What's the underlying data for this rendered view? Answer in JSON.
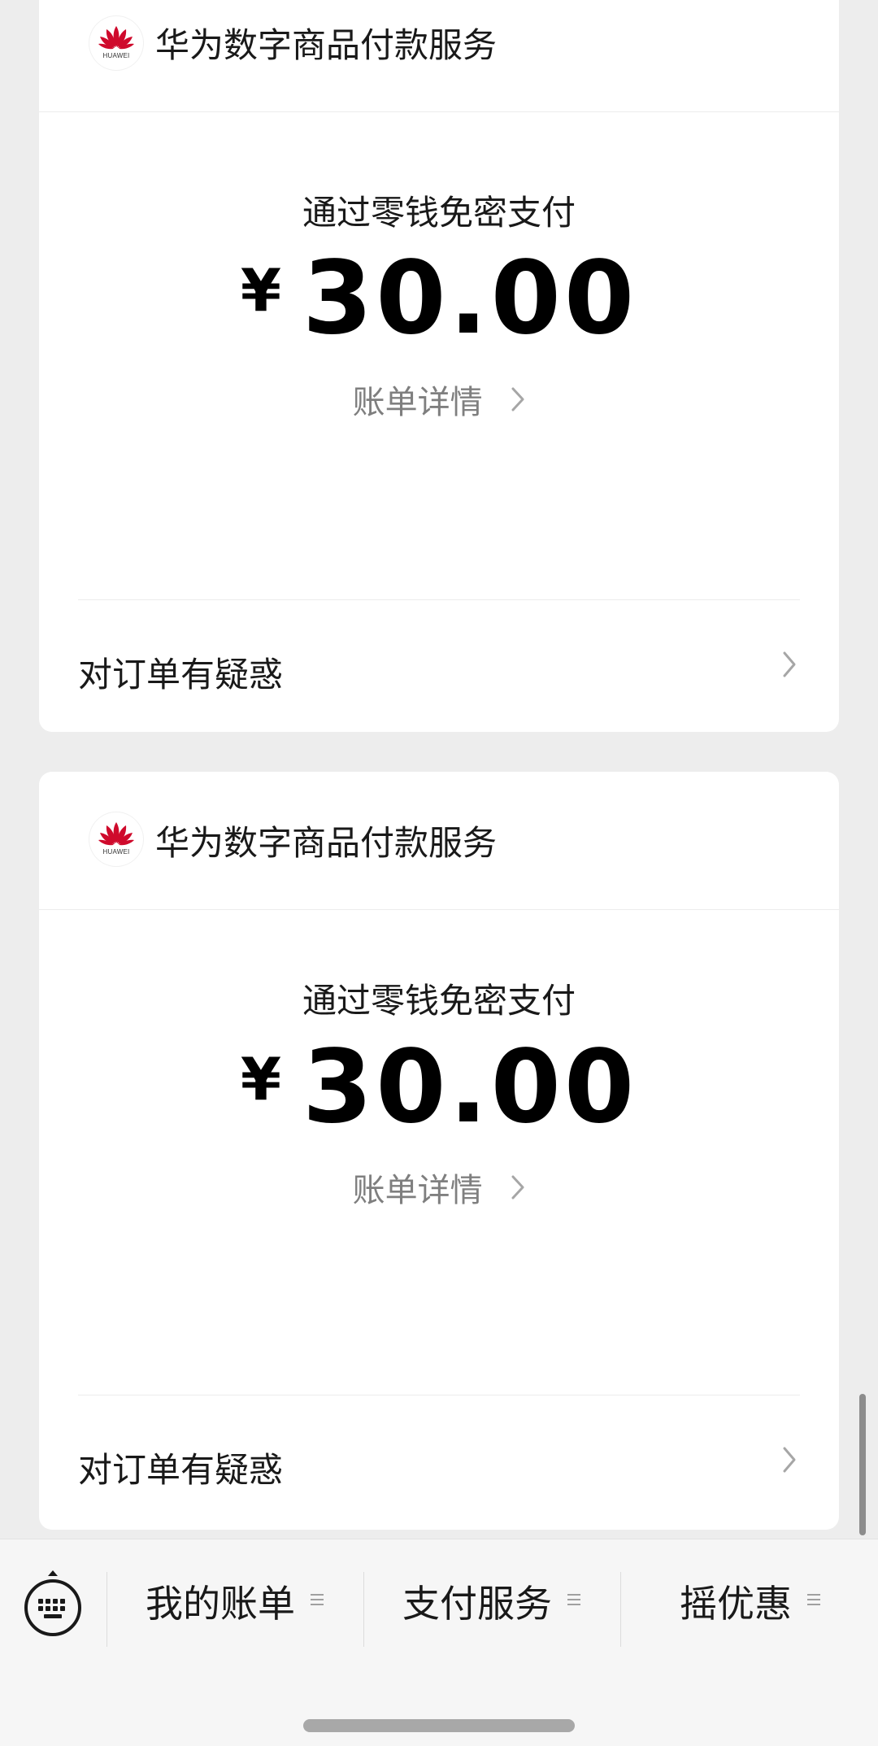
{
  "bills": [
    {
      "merchant": {
        "name": "华为数字商品付款服务",
        "logo_text": "HUAWEI",
        "logo_icon": "huawei-logo-icon",
        "logo_color": "#cf0a2c"
      },
      "pay_method": "通过零钱免密支付",
      "currency": "¥",
      "amount": "30.00",
      "detail_label": "账单详情",
      "question_label": "对订单有疑惑"
    },
    {
      "merchant": {
        "name": "华为数字商品付款服务",
        "logo_text": "HUAWEI",
        "logo_icon": "huawei-logo-icon",
        "logo_color": "#cf0a2c"
      },
      "pay_method": "通过零钱免密支付",
      "currency": "¥",
      "amount": "30.00",
      "detail_label": "账单详情",
      "question_label": "对订单有疑惑"
    }
  ],
  "bottom_menu": {
    "keyboard_icon": "keyboard-icon",
    "items": [
      {
        "label": "我的账单",
        "icon": "menu-lines-icon"
      },
      {
        "label": "支付服务",
        "icon": "menu-lines-icon"
      },
      {
        "label": "摇优惠",
        "icon": "menu-lines-icon"
      }
    ]
  },
  "colors": {
    "background": "#ededed",
    "card": "#ffffff",
    "primary_text": "#191919",
    "secondary_text": "#7f7f7f"
  }
}
